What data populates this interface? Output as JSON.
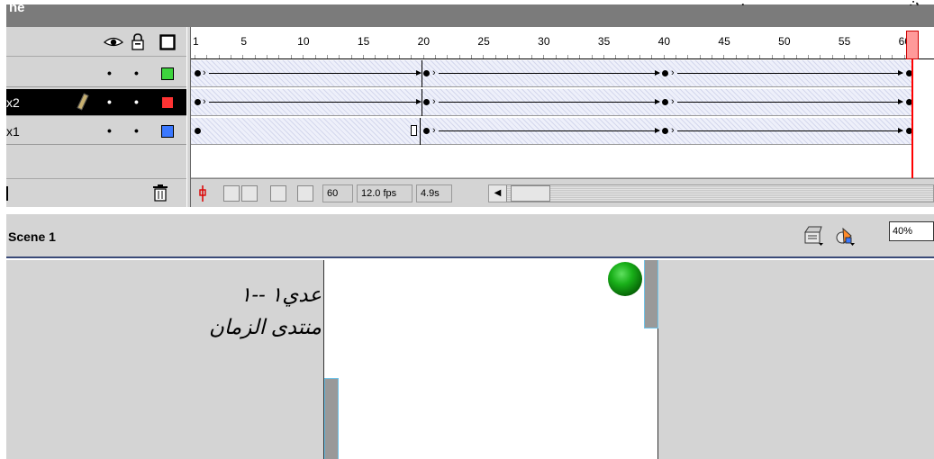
{
  "window": {
    "title_partial": "ne"
  },
  "timeline": {
    "header_icons": [
      "eye-icon",
      "lock-icon",
      "outline-square-icon"
    ],
    "frame_numbers": [
      "1",
      "5",
      "10",
      "15",
      "20",
      "25",
      "30",
      "35",
      "40",
      "45",
      "50",
      "55",
      "60"
    ],
    "current_frame_marker": "60",
    "layers": [
      {
        "name": "",
        "color": "#3ed43e",
        "selected": false
      },
      {
        "name": "x2",
        "color": "#ff3333",
        "selected": true
      },
      {
        "name": "x1",
        "color": "#3a78ff",
        "selected": false
      }
    ],
    "status": {
      "frame": "60",
      "fps": "12.0 fps",
      "time": "4.9s"
    }
  },
  "scene": {
    "name": "Scene 1",
    "zoom": "40%",
    "icons": [
      "edit-scene-icon",
      "edit-symbol-icon"
    ]
  },
  "stage": {
    "text_lines": [
      "عدي١ --١",
      "منتدى الزمان"
    ],
    "ball_color": "#19b019",
    "paddle_color": "#999999"
  },
  "colors": {
    "panel_bg": "#d4d4d4",
    "accent": "#3a4a78",
    "playhead": "#ff0000"
  }
}
